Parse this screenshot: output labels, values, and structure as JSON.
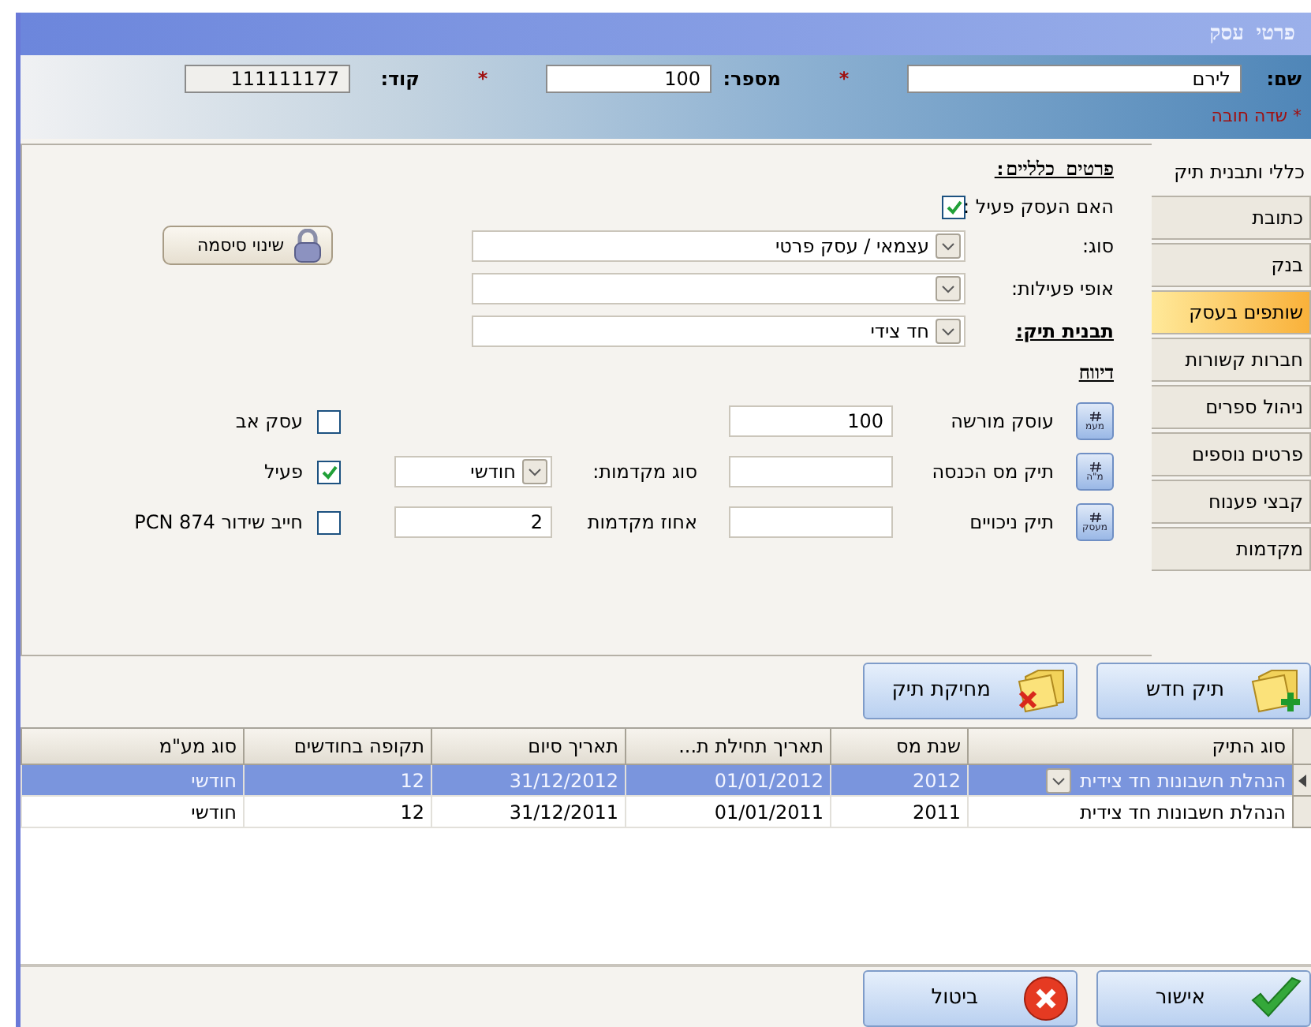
{
  "window": {
    "title": "פרטי עסק"
  },
  "header": {
    "fields": [
      {
        "label": "שם:",
        "value": "לירם",
        "required_mark": "*",
        "readonly": false
      },
      {
        "label": "מספר:",
        "value": "100",
        "required_mark": "*",
        "readonly": false
      },
      {
        "label": "קוד:",
        "value": "111111177",
        "readonly": true
      }
    ],
    "required_note": "* שדה חובה"
  },
  "tabs": [
    {
      "label": "כללי ותבנית תיק",
      "selected": true,
      "highlighted": false
    },
    {
      "label": "כתובת",
      "selected": false,
      "highlighted": false
    },
    {
      "label": "בנק",
      "selected": false,
      "highlighted": false
    },
    {
      "label": "שותפים בעסק",
      "selected": false,
      "highlighted": true
    },
    {
      "label": "חברות קשורות",
      "selected": false,
      "highlighted": false
    },
    {
      "label": "ניהול ספרים",
      "selected": false,
      "highlighted": false
    },
    {
      "label": "פרטים נוספים",
      "selected": false,
      "highlighted": false
    },
    {
      "label": "קבצי פענוח",
      "selected": false,
      "highlighted": false
    },
    {
      "label": "מקדמות",
      "selected": false,
      "highlighted": false
    }
  ],
  "general": {
    "heading": "פרטים כלליים:",
    "active": {
      "label": "האם העסק פעיל :",
      "checked": true
    },
    "selects": [
      {
        "label": "סוג:",
        "value": "עצמאי / עסק פרטי",
        "underlined": false
      },
      {
        "label": "אופי פעילות:",
        "underlined": false
      },
      {
        "label": "תבנית תיק:",
        "value": "חד צידי",
        "underlined": true
      }
    ],
    "password_button": "שינוי סיסמה"
  },
  "reporting": {
    "heading": "דיווח",
    "rows": [
      {
        "badge": "מעמ",
        "label": "עוסק מורשה",
        "value": "100",
        "check": {
          "label": "עסק אב",
          "checked": false
        }
      },
      {
        "badge": "מ\"ה",
        "label": "תיק מס הכנסה",
        "extra": {
          "kind": "select",
          "label": "סוג מקדמות:",
          "value": "חודשי"
        },
        "check": {
          "label": "פעיל",
          "checked": true
        }
      },
      {
        "badge": "מעסק",
        "label": "תיק ניכויים",
        "extra": {
          "kind": "input",
          "label": "אחוז מקדמות",
          "value": "2"
        },
        "check": {
          "label": "חייב שידור PCN 874",
          "checked": false
        }
      }
    ]
  },
  "file_buttons": [
    {
      "label": "תיק חדש",
      "kind": "add"
    },
    {
      "label": "מחיקת תיק",
      "kind": "delete"
    }
  ],
  "table": {
    "columns": [
      "סוג התיק",
      "שנת מס",
      "תאריך תחילת ת...",
      "תאריך סיום",
      "תקופה בחודשים",
      "סוג מע\"מ"
    ],
    "rows": [
      {
        "selected": true,
        "cells": [
          "הנהלת חשבונות חד צידית",
          "2012",
          "01/01/2012",
          "31/12/2012",
          "12",
          "חודשי"
        ]
      },
      {
        "selected": false,
        "cells": [
          "הנהלת חשבונות חד צידית",
          "2011",
          "01/01/2011",
          "31/12/2011",
          "12",
          "חודשי"
        ]
      }
    ]
  },
  "footer_buttons": [
    {
      "label": "אישור",
      "kind": "ok"
    },
    {
      "label": "ביטול",
      "kind": "cancel"
    }
  ]
}
